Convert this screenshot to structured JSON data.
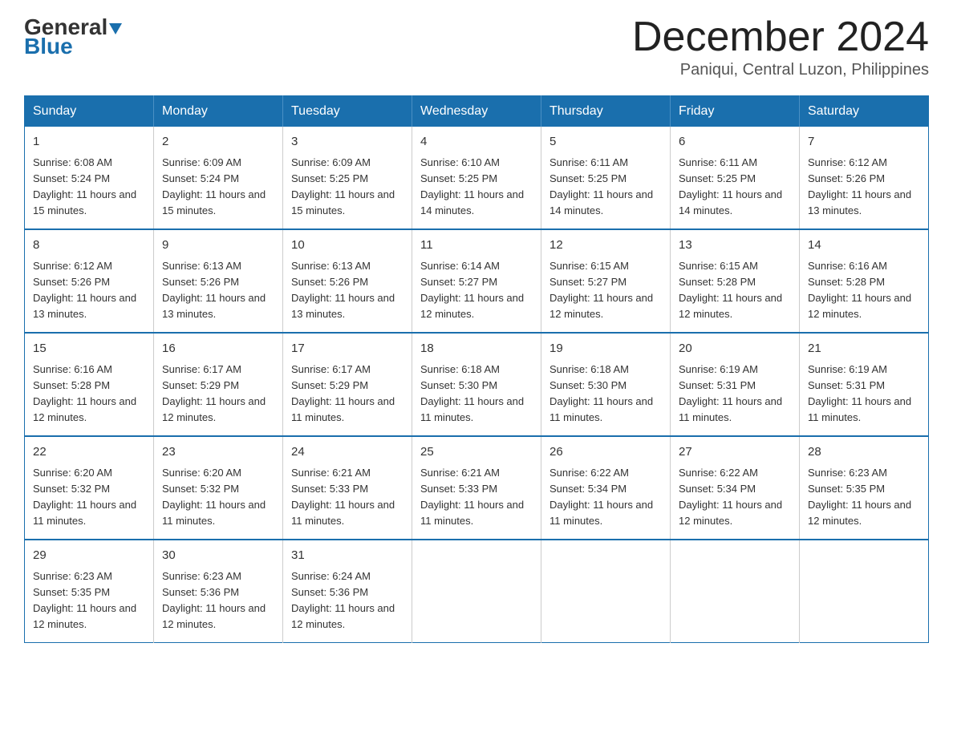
{
  "header": {
    "logo_general": "General",
    "logo_blue": "Blue",
    "month_title": "December 2024",
    "location": "Paniqui, Central Luzon, Philippines"
  },
  "days_of_week": [
    "Sunday",
    "Monday",
    "Tuesday",
    "Wednesday",
    "Thursday",
    "Friday",
    "Saturday"
  ],
  "weeks": [
    [
      {
        "day": "1",
        "sunrise": "6:08 AM",
        "sunset": "5:24 PM",
        "daylight": "11 hours and 15 minutes."
      },
      {
        "day": "2",
        "sunrise": "6:09 AM",
        "sunset": "5:24 PM",
        "daylight": "11 hours and 15 minutes."
      },
      {
        "day": "3",
        "sunrise": "6:09 AM",
        "sunset": "5:25 PM",
        "daylight": "11 hours and 15 minutes."
      },
      {
        "day": "4",
        "sunrise": "6:10 AM",
        "sunset": "5:25 PM",
        "daylight": "11 hours and 14 minutes."
      },
      {
        "day": "5",
        "sunrise": "6:11 AM",
        "sunset": "5:25 PM",
        "daylight": "11 hours and 14 minutes."
      },
      {
        "day": "6",
        "sunrise": "6:11 AM",
        "sunset": "5:25 PM",
        "daylight": "11 hours and 14 minutes."
      },
      {
        "day": "7",
        "sunrise": "6:12 AM",
        "sunset": "5:26 PM",
        "daylight": "11 hours and 13 minutes."
      }
    ],
    [
      {
        "day": "8",
        "sunrise": "6:12 AM",
        "sunset": "5:26 PM",
        "daylight": "11 hours and 13 minutes."
      },
      {
        "day": "9",
        "sunrise": "6:13 AM",
        "sunset": "5:26 PM",
        "daylight": "11 hours and 13 minutes."
      },
      {
        "day": "10",
        "sunrise": "6:13 AM",
        "sunset": "5:26 PM",
        "daylight": "11 hours and 13 minutes."
      },
      {
        "day": "11",
        "sunrise": "6:14 AM",
        "sunset": "5:27 PM",
        "daylight": "11 hours and 12 minutes."
      },
      {
        "day": "12",
        "sunrise": "6:15 AM",
        "sunset": "5:27 PM",
        "daylight": "11 hours and 12 minutes."
      },
      {
        "day": "13",
        "sunrise": "6:15 AM",
        "sunset": "5:28 PM",
        "daylight": "11 hours and 12 minutes."
      },
      {
        "day": "14",
        "sunrise": "6:16 AM",
        "sunset": "5:28 PM",
        "daylight": "11 hours and 12 minutes."
      }
    ],
    [
      {
        "day": "15",
        "sunrise": "6:16 AM",
        "sunset": "5:28 PM",
        "daylight": "11 hours and 12 minutes."
      },
      {
        "day": "16",
        "sunrise": "6:17 AM",
        "sunset": "5:29 PM",
        "daylight": "11 hours and 12 minutes."
      },
      {
        "day": "17",
        "sunrise": "6:17 AM",
        "sunset": "5:29 PM",
        "daylight": "11 hours and 11 minutes."
      },
      {
        "day": "18",
        "sunrise": "6:18 AM",
        "sunset": "5:30 PM",
        "daylight": "11 hours and 11 minutes."
      },
      {
        "day": "19",
        "sunrise": "6:18 AM",
        "sunset": "5:30 PM",
        "daylight": "11 hours and 11 minutes."
      },
      {
        "day": "20",
        "sunrise": "6:19 AM",
        "sunset": "5:31 PM",
        "daylight": "11 hours and 11 minutes."
      },
      {
        "day": "21",
        "sunrise": "6:19 AM",
        "sunset": "5:31 PM",
        "daylight": "11 hours and 11 minutes."
      }
    ],
    [
      {
        "day": "22",
        "sunrise": "6:20 AM",
        "sunset": "5:32 PM",
        "daylight": "11 hours and 11 minutes."
      },
      {
        "day": "23",
        "sunrise": "6:20 AM",
        "sunset": "5:32 PM",
        "daylight": "11 hours and 11 minutes."
      },
      {
        "day": "24",
        "sunrise": "6:21 AM",
        "sunset": "5:33 PM",
        "daylight": "11 hours and 11 minutes."
      },
      {
        "day": "25",
        "sunrise": "6:21 AM",
        "sunset": "5:33 PM",
        "daylight": "11 hours and 11 minutes."
      },
      {
        "day": "26",
        "sunrise": "6:22 AM",
        "sunset": "5:34 PM",
        "daylight": "11 hours and 11 minutes."
      },
      {
        "day": "27",
        "sunrise": "6:22 AM",
        "sunset": "5:34 PM",
        "daylight": "11 hours and 12 minutes."
      },
      {
        "day": "28",
        "sunrise": "6:23 AM",
        "sunset": "5:35 PM",
        "daylight": "11 hours and 12 minutes."
      }
    ],
    [
      {
        "day": "29",
        "sunrise": "6:23 AM",
        "sunset": "5:35 PM",
        "daylight": "11 hours and 12 minutes."
      },
      {
        "day": "30",
        "sunrise": "6:23 AM",
        "sunset": "5:36 PM",
        "daylight": "11 hours and 12 minutes."
      },
      {
        "day": "31",
        "sunrise": "6:24 AM",
        "sunset": "5:36 PM",
        "daylight": "11 hours and 12 minutes."
      },
      null,
      null,
      null,
      null
    ]
  ],
  "labels": {
    "sunrise_prefix": "Sunrise: ",
    "sunset_prefix": "Sunset: ",
    "daylight_prefix": "Daylight: "
  }
}
